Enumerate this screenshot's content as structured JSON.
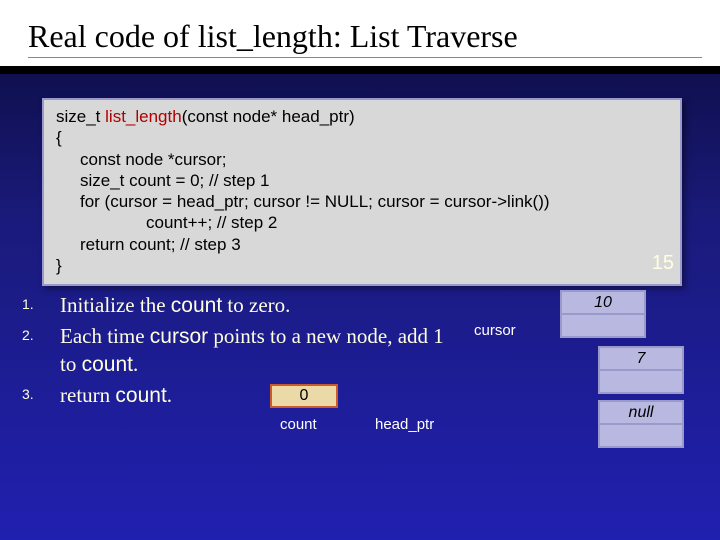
{
  "title": "Real code of list_length: List Traverse",
  "page_number": "15",
  "code": {
    "sig_pre": "size_t ",
    "fn_name": "list_length",
    "sig_post": "(const node* head_ptr)",
    "open_brace": "{",
    "l1": "const node *cursor;",
    "l2": "size_t count = 0;  // step 1",
    "l3": "for (cursor = head_ptr; cursor != NULL; cursor = cursor->link())",
    "l4": "count++;  // step 2",
    "l5": "return count;  // step 3",
    "close_brace": "}"
  },
  "steps": {
    "n1": "1.",
    "t1a": "Initialize the ",
    "t1b": "count",
    "t1c": " to zero.",
    "n2": "2.",
    "t2a": "Each time ",
    "t2b": "cursor",
    "t2c": " points to a new node, add 1 to ",
    "t2d": "count",
    "t2e": ".",
    "n3": "3.",
    "t3a": "return ",
    "t3b": "count",
    "t3c": "."
  },
  "diagram": {
    "count_value": "0",
    "count_label": "count",
    "headptr_label": "head_ptr",
    "cursor_label": "cursor",
    "node1_value": "10",
    "node2_value": "7",
    "node3_value": "null"
  }
}
